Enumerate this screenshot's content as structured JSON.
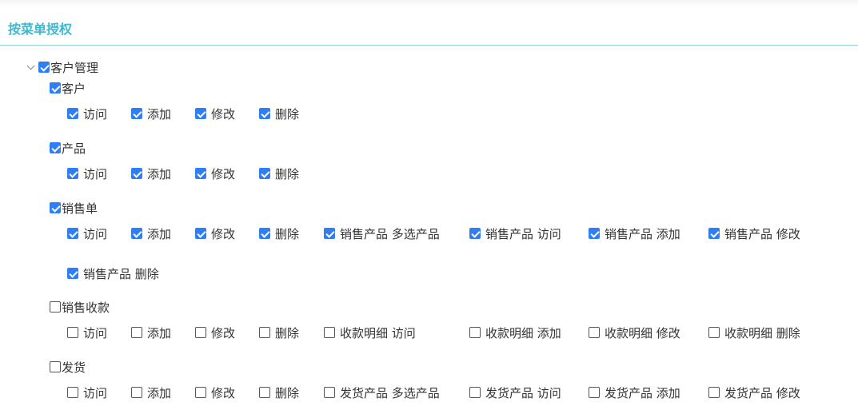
{
  "section_title": "按菜单授权",
  "root": {
    "label": "客户管理",
    "checked": true,
    "expanded": true
  },
  "groups": [
    {
      "label": "客户",
      "checked": true,
      "rows": [
        [
          {
            "label": "访问",
            "checked": true
          },
          {
            "label": "添加",
            "checked": true
          },
          {
            "label": "修改",
            "checked": true
          },
          {
            "label": "删除",
            "checked": true
          }
        ]
      ]
    },
    {
      "label": "产品",
      "checked": true,
      "rows": [
        [
          {
            "label": "访问",
            "checked": true
          },
          {
            "label": "添加",
            "checked": true
          },
          {
            "label": "修改",
            "checked": true
          },
          {
            "label": "删除",
            "checked": true
          }
        ]
      ]
    },
    {
      "label": "销售单",
      "checked": true,
      "rows": [
        [
          {
            "label": "访问",
            "checked": true
          },
          {
            "label": "添加",
            "checked": true
          },
          {
            "label": "修改",
            "checked": true
          },
          {
            "label": "删除",
            "checked": true
          },
          {
            "label": "销售产品 多选产品",
            "checked": true
          },
          {
            "label": "销售产品 访问",
            "checked": true
          },
          {
            "label": "销售产品 添加",
            "checked": true
          },
          {
            "label": "销售产品 修改",
            "checked": true
          }
        ],
        [
          {
            "label": "销售产品 删除",
            "checked": true
          }
        ]
      ]
    },
    {
      "label": "销售收款",
      "checked": false,
      "rows": [
        [
          {
            "label": "访问",
            "checked": false
          },
          {
            "label": "添加",
            "checked": false
          },
          {
            "label": "修改",
            "checked": false
          },
          {
            "label": "删除",
            "checked": false
          },
          {
            "label": "收款明细 访问",
            "checked": false
          },
          {
            "label": "收款明细 添加",
            "checked": false
          },
          {
            "label": "收款明细 修改",
            "checked": false
          },
          {
            "label": "收款明细 删除",
            "checked": false
          }
        ]
      ]
    },
    {
      "label": "发货",
      "checked": false,
      "rows": [
        [
          {
            "label": "访问",
            "checked": false
          },
          {
            "label": "添加",
            "checked": false
          },
          {
            "label": "修改",
            "checked": false
          },
          {
            "label": "删除",
            "checked": false
          },
          {
            "label": "发货产品 多选产品",
            "checked": false
          },
          {
            "label": "发货产品 访问",
            "checked": false
          },
          {
            "label": "发货产品 添加",
            "checked": false
          },
          {
            "label": "发货产品 修改",
            "checked": false
          }
        ]
      ]
    }
  ]
}
